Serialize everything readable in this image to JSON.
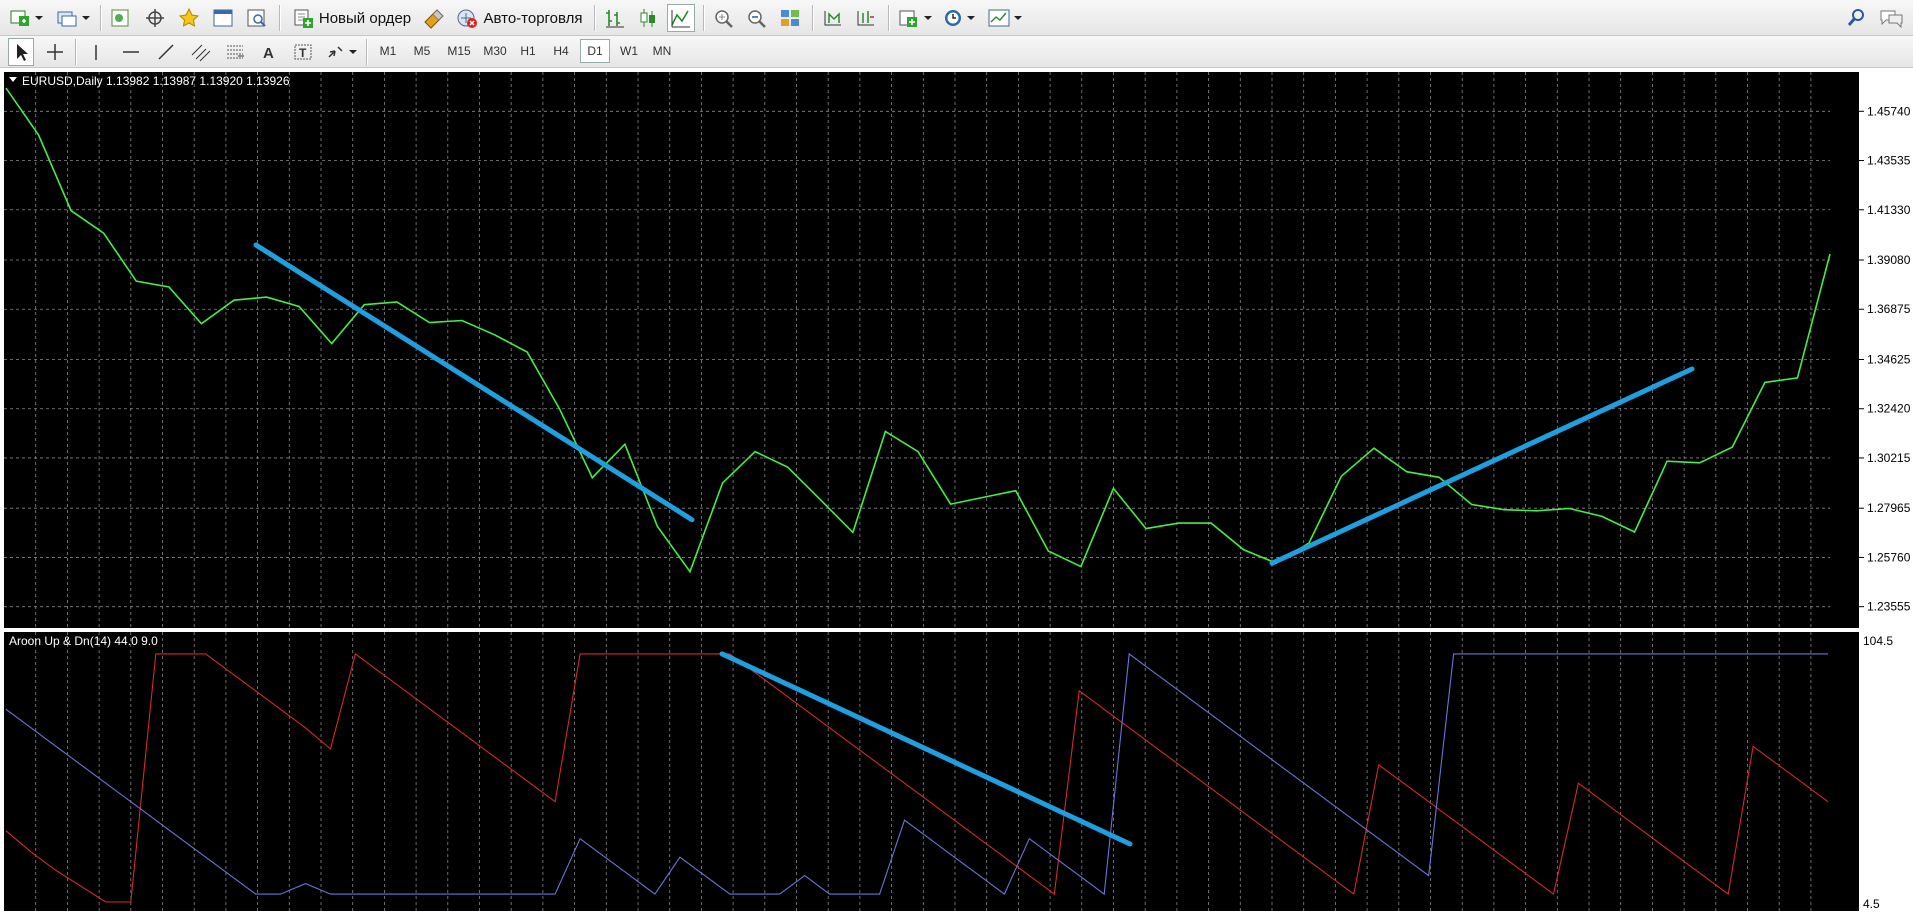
{
  "toolbar": {
    "new_order_label": "Новый ордер",
    "autotrading_label": "Авто-торговля"
  },
  "timeframes": [
    "M1",
    "M5",
    "M15",
    "M30",
    "H1",
    "H4",
    "D1",
    "W1",
    "MN"
  ],
  "active_timeframe": "D1",
  "main_chart": {
    "legend": "EURUSD,Daily  1.13982 1.13987 1.13920 1.13926",
    "price_levels": [
      "1.45740",
      "1.43535",
      "1.41330",
      "1.39080",
      "1.36875",
      "1.34625",
      "1.32420",
      "1.30215",
      "1.27965",
      "1.25760",
      "1.23555"
    ],
    "line_color": "#44ee44",
    "trendline_color": "#1e9fe0"
  },
  "indicator": {
    "legend": "Aroon Up & Dn(14) 44.0 9.0",
    "scale_max": "104.5",
    "scale_min": "4.5",
    "up_color": "#d42a2a",
    "down_color": "#6c74d8"
  },
  "chart_data": [
    {
      "type": "line",
      "title": "EURUSD,Daily",
      "ylim": [
        1.226,
        1.475
      ],
      "series": [
        {
          "values": [
            1.4678,
            1.4468,
            1.4129,
            1.4028,
            1.3813,
            1.3787,
            1.3623,
            1.3728,
            1.3742,
            1.37,
            1.3534,
            1.3708,
            1.372,
            1.3628,
            1.3637,
            1.3573,
            1.3496,
            1.324,
            1.2933,
            1.3083,
            1.2715,
            1.2512,
            1.291,
            1.305,
            1.298,
            1.2835,
            1.2688,
            1.314,
            1.305,
            1.2815,
            1.2845,
            1.2875,
            1.2605,
            1.2535,
            1.2885,
            1.2705,
            1.273,
            1.273,
            1.261,
            1.255,
            1.264,
            1.294,
            1.3065,
            1.296,
            1.2935,
            1.2813,
            1.279,
            1.2785,
            1.2795,
            1.276,
            1.269,
            1.3007,
            1.3,
            1.307,
            1.336,
            1.338,
            1.3935
          ]
        }
      ]
    },
    {
      "type": "line",
      "title": "Aroon Up & Dn(14) 44.0 9.0",
      "ylim": [
        4.5,
        104.5
      ],
      "series": [
        {
          "values": [
            33,
            25,
            18,
            12,
            6,
            6,
            100,
            100,
            100,
            93,
            86,
            79,
            72,
            64,
            100,
            93,
            86,
            79,
            72,
            65,
            58,
            51,
            44,
            100,
            100,
            100,
            100,
            100,
            100,
            100,
            93,
            86,
            79,
            72,
            65,
            58,
            51,
            44,
            37,
            30,
            23,
            16,
            9,
            86,
            79,
            72,
            65,
            58,
            51,
            44,
            37,
            30,
            23,
            16,
            9,
            58,
            51,
            44,
            37,
            30,
            23,
            16,
            9,
            51,
            44,
            37,
            30,
            23,
            16,
            9,
            65,
            58,
            51,
            44
          ]
        },
        {
          "values": [
            79,
            72,
            65,
            58,
            51,
            44,
            37,
            30,
            23,
            16,
            9,
            9,
            13,
            9,
            9,
            9,
            9,
            9,
            9,
            9,
            9,
            9,
            9,
            30,
            23,
            16,
            9,
            23,
            16,
            9,
            9,
            9,
            16,
            9,
            9,
            9,
            37,
            30,
            23,
            16,
            9,
            30,
            23,
            16,
            9,
            100,
            93,
            86,
            79,
            72,
            65,
            58,
            51,
            44,
            37,
            30,
            23,
            16,
            100,
            100,
            100,
            100,
            100,
            100,
            100,
            100,
            100,
            100,
            100,
            100,
            100,
            100,
            100,
            100
          ]
        }
      ]
    }
  ]
}
